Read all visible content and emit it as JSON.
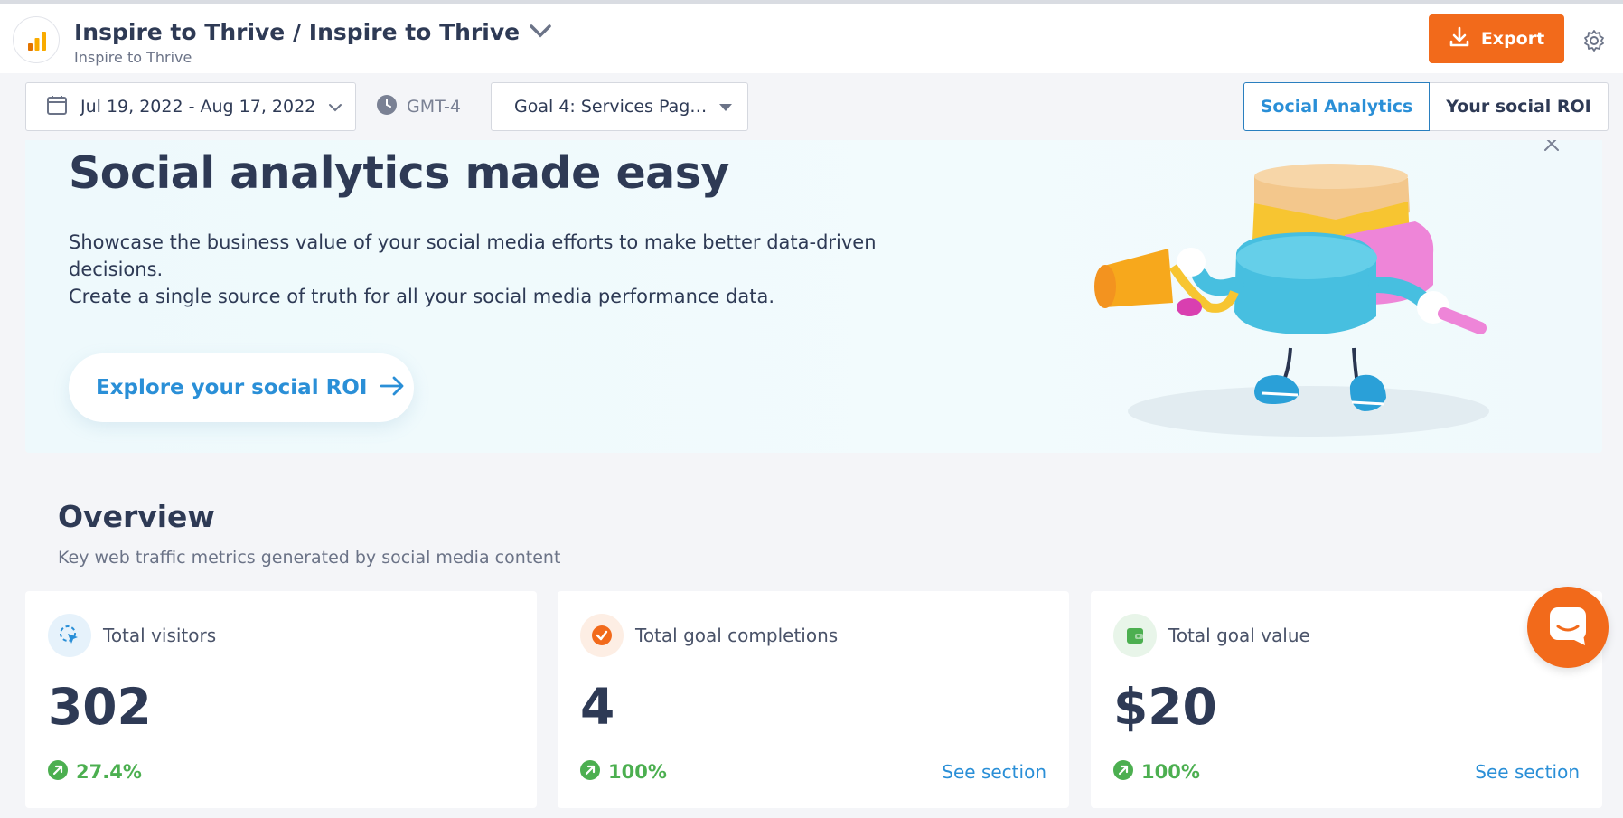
{
  "header": {
    "title": "Inspire to Thrive / Inspire to Thrive",
    "subtitle": "Inspire to Thrive",
    "export_label": "Export"
  },
  "filters": {
    "date_range": "Jul 19, 2022 - Aug 17, 2022",
    "timezone": "GMT-4",
    "goal": "Goal 4: Services Pag…"
  },
  "tabs": [
    {
      "label": "Social Analytics",
      "active": true
    },
    {
      "label": "Your social ROI",
      "active": false
    }
  ],
  "banner": {
    "title": "Social analytics made easy",
    "line1": "Showcase the business value of your social media efforts to make better data-driven decisions.",
    "line2": "Create a single source of truth for all your social media performance data.",
    "cta_label": "Explore your social ROI"
  },
  "overview": {
    "title": "Overview",
    "subtitle": "Key web traffic metrics generated by social media content",
    "cards": [
      {
        "label": "Total visitors",
        "value": "302",
        "change": "27.4%",
        "link": "",
        "icon": "cursor-click-icon",
        "icon_color": "#2a8fd7",
        "icon_bg": "#e6f2fb"
      },
      {
        "label": "Total goal completions",
        "value": "4",
        "change": "100%",
        "link": "See section",
        "icon": "check-circle-icon",
        "icon_color": "#f26a1b",
        "icon_bg": "#fdeee4"
      },
      {
        "label": "Total goal value",
        "value": "$20",
        "change": "100%",
        "link": "See section",
        "icon": "wallet-icon",
        "icon_color": "#4caf50",
        "icon_bg": "#e8f5e9"
      }
    ]
  },
  "colors": {
    "accent": "#f26a1b",
    "link": "#2a8fd7",
    "positive": "#4caf50",
    "text": "#2e3a55"
  }
}
